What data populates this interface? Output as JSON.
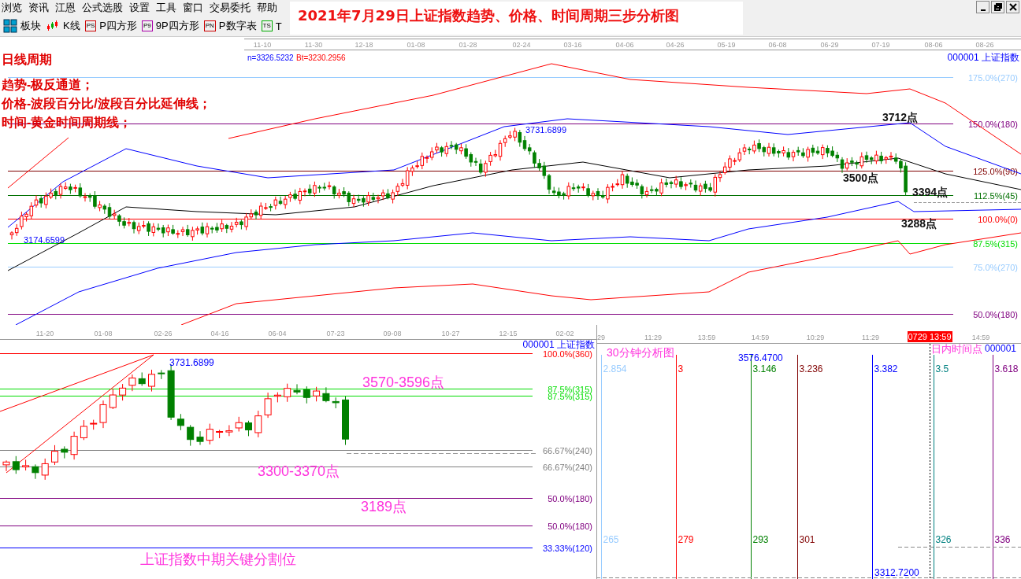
{
  "menu": [
    "浏览",
    "资讯",
    "江恩",
    "公式选股",
    "设置",
    "工具",
    "窗口",
    "交易委托",
    "帮助"
  ],
  "toolbar": [
    {
      "label": "板块",
      "kind": "grid"
    },
    {
      "label": "K线",
      "kind": "candles"
    },
    {
      "label": "P四方形",
      "kind": "badge",
      "badge": "PS",
      "color": "#cc0000"
    },
    {
      "label": "9P四方形",
      "kind": "badge",
      "badge": "P9",
      "color": "#aa00aa"
    },
    {
      "label": "P数字表",
      "kind": "badge",
      "badge": "PN",
      "color": "#cc0000"
    },
    {
      "label": "T",
      "kind": "badge",
      "badge": "TS",
      "color": "#00aa00"
    }
  ],
  "title": "2021年7月29日上证指数趋势、价格、时间周期三步分析图",
  "daily_chart": {
    "dates": [
      "11-10",
      "11-30",
      "12-18",
      "01-08",
      "01-28",
      "02-24",
      "03-16",
      "04-06",
      "04-26",
      "05-19",
      "06-08",
      "06-29",
      "07-19",
      "08-06",
      "08-26"
    ],
    "caption": "日线周期",
    "notes": [
      "趋势-极反通道；",
      "价格-波段百分比/波段百分比延伸线；",
      "时间-黄金时间周期线；"
    ],
    "dn": "n=3326.5232",
    "bt": "Bt=3230.2956",
    "symbol": "000001  上证指数",
    "levels": [
      {
        "label": "175.0%(270)",
        "color": "#99ccff"
      },
      {
        "label": "150.0%(180)",
        "color": "#800080"
      },
      {
        "label": "125.0%(90)",
        "color": "#800000"
      },
      {
        "label": "112.5%(45)",
        "color": "#007000"
      },
      {
        "label": "100.0%(0)",
        "color": "#ff0000"
      },
      {
        "label": "87.5%(315)",
        "color": "#00dd00"
      },
      {
        "label": "75.0%(270)",
        "color": "#99ccff"
      },
      {
        "label": "50.0%(180)",
        "color": "#800080"
      }
    ],
    "points": [
      {
        "label": "3712点",
        "kind": "bold"
      },
      {
        "label": "3500点",
        "kind": "bold"
      },
      {
        "label": "3394点",
        "kind": "bold"
      },
      {
        "label": "3288点",
        "kind": "bold"
      },
      {
        "label": "3731.6899",
        "kind": "price"
      },
      {
        "label": "3174.6599",
        "kind": "price"
      }
    ]
  },
  "segment_chart": {
    "dates": [
      "11-20",
      "01-08",
      "02-26",
      "04-16",
      "06-04",
      "07-23",
      "09-08",
      "10-27",
      "12-15",
      "02-02"
    ],
    "symbol": "000001  上证指数",
    "levels": [
      {
        "label": "100.0%(360)",
        "color": "#ff0000"
      },
      {
        "label": "87.5%(315)",
        "color": "#00dd00"
      },
      {
        "label": "87.5%(315)",
        "color": "#00dd00"
      },
      {
        "label": "66.67%(240)",
        "color": "#808080"
      },
      {
        "label": "66.67%(240)",
        "color": "#808080"
      },
      {
        "label": "50.0%(180)",
        "color": "#800080"
      },
      {
        "label": "50.0%(180)",
        "color": "#800080"
      },
      {
        "label": "33.33%(120)",
        "color": "#0000ff"
      }
    ],
    "price": "3731.6899",
    "notes": [
      "3570-3596点",
      "3300-3370点",
      "3189点",
      "上证指数中期关键分割位"
    ]
  },
  "intraday_chart": {
    "times": [
      "29",
      "11:29",
      "13:59",
      "14:59",
      "10:29",
      "11:29"
    ],
    "current_time": "0729 13:59",
    "times_after": [
      "14:59"
    ],
    "title": "30分钟分析图",
    "label": "日内时间点",
    "symbol": "000001",
    "time_lines": [
      {
        "ratio": "2.854",
        "count": "265",
        "color": "#99ccff"
      },
      {
        "ratio": "3",
        "count": "279",
        "color": "#ff0000"
      },
      {
        "ratio": "3.146",
        "count": "293",
        "color": "#008000"
      },
      {
        "ratio": "3.236",
        "count": "301",
        "color": "#800000"
      },
      {
        "ratio": "3.382",
        "color": "#0000ff"
      },
      {
        "ratio": "3.5",
        "count": "326",
        "color": "#008080"
      },
      {
        "ratio": "3.618",
        "count": "336",
        "color": "#800080"
      }
    ],
    "prices": [
      "3576.4700",
      "3312.7200"
    ]
  }
}
